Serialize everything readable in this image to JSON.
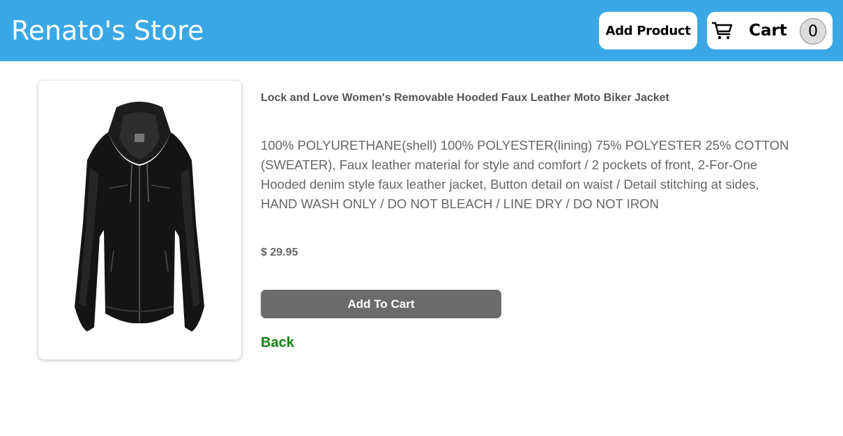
{
  "header": {
    "store_title": "Renato's Store",
    "add_product_label": "Add Product",
    "cart_label": "Cart",
    "cart_count": "0",
    "cart_icon": "shopping-cart-icon",
    "background_color": "#3aa8e6"
  },
  "product": {
    "image_icon": "black-faux-leather-jacket-image",
    "title": "Lock and Love Women's Removable Hooded Faux Leather Moto Biker Jacket",
    "description": "100% POLYURETHANE(shell) 100% POLYESTER(lining) 75% POLYESTER 25% COTTON (SWEATER), Faux leather material for style and comfort / 2 pockets of front, 2-For-One Hooded denim style faux leather jacket, Button detail on waist / Detail stitching at sides, HAND WASH ONLY / DO NOT BLEACH / LINE DRY / DO NOT IRON",
    "price": "$ 29.95",
    "add_to_cart_label": "Add To Cart",
    "back_label": "Back",
    "back_color": "#128012"
  }
}
